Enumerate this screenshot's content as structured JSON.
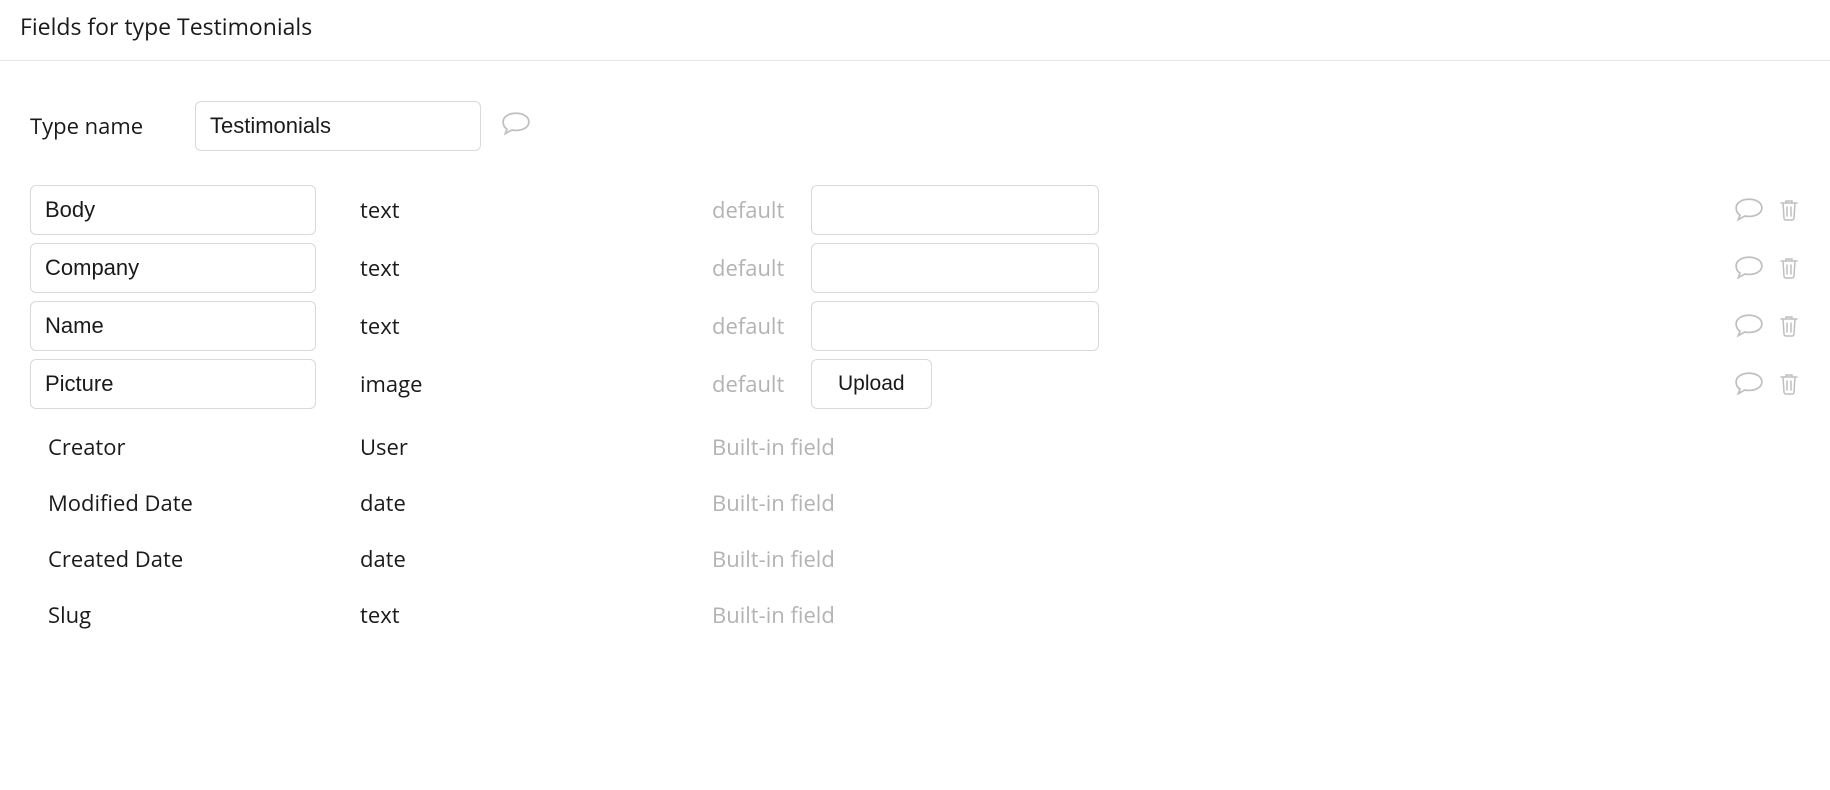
{
  "header": {
    "title": "Fields for type Testimonials"
  },
  "type_name": {
    "label": "Type name",
    "value": "Testimonials"
  },
  "default_label": "default",
  "upload_label": "Upload",
  "builtin_label": "Built-in field",
  "fields": [
    {
      "name": "Body",
      "type": "text",
      "default": "",
      "inputKind": "text"
    },
    {
      "name": "Company",
      "type": "text",
      "default": "",
      "inputKind": "text"
    },
    {
      "name": "Name",
      "type": "text",
      "default": "",
      "inputKind": "text"
    },
    {
      "name": "Picture",
      "type": "image",
      "default": "",
      "inputKind": "upload"
    }
  ],
  "builtin_fields": [
    {
      "name": "Creator",
      "type": "User"
    },
    {
      "name": "Modified Date",
      "type": "date"
    },
    {
      "name": "Created Date",
      "type": "date"
    },
    {
      "name": "Slug",
      "type": "text"
    }
  ]
}
